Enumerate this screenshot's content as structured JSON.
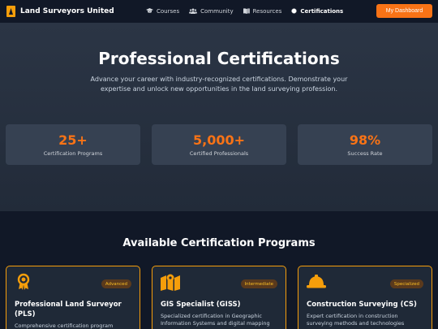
{
  "nav": {
    "brand": "Land Surveyors United",
    "links": [
      {
        "label": "Courses",
        "icon": "graduation-cap-icon"
      },
      {
        "label": "Community",
        "icon": "users-icon"
      },
      {
        "label": "Resources",
        "icon": "book-icon"
      },
      {
        "label": "Certifications",
        "icon": "certificate-icon"
      }
    ],
    "dashboard_button": "My Dashboard"
  },
  "hero": {
    "title": "Professional Certifications",
    "subtitle": "Advance your career with industry-recognized certifications. Demonstrate your expertise and unlock new opportunities in the land surveying profession.",
    "stats": [
      {
        "value": "25+",
        "label": "Certification Programs"
      },
      {
        "value": "5,000+",
        "label": "Certified Professionals"
      },
      {
        "value": "98%",
        "label": "Success Rate"
      }
    ]
  },
  "programs": {
    "title": "Available Certification Programs",
    "cards": [
      {
        "icon": "award-icon",
        "badge": "Advanced",
        "title": "Professional Land Surveyor (PLS)",
        "description": "Comprehensive certification program"
      },
      {
        "icon": "map-icon",
        "badge": "Intermediate",
        "title": "GIS Specialist (GISS)",
        "description": "Specialized certification in Geographic Information Systems and digital mapping"
      },
      {
        "icon": "hard-hat-icon",
        "badge": "Specialized",
        "title": "Construction Surveying (CS)",
        "description": "Expert certification in construction surveying methods and technologies"
      }
    ]
  },
  "colors": {
    "accent": "#f97316",
    "badge_text": "#fbbf24",
    "card_border": "#f59e0b",
    "nav_bg": "#111827",
    "hero_bg": "#2b3545"
  }
}
